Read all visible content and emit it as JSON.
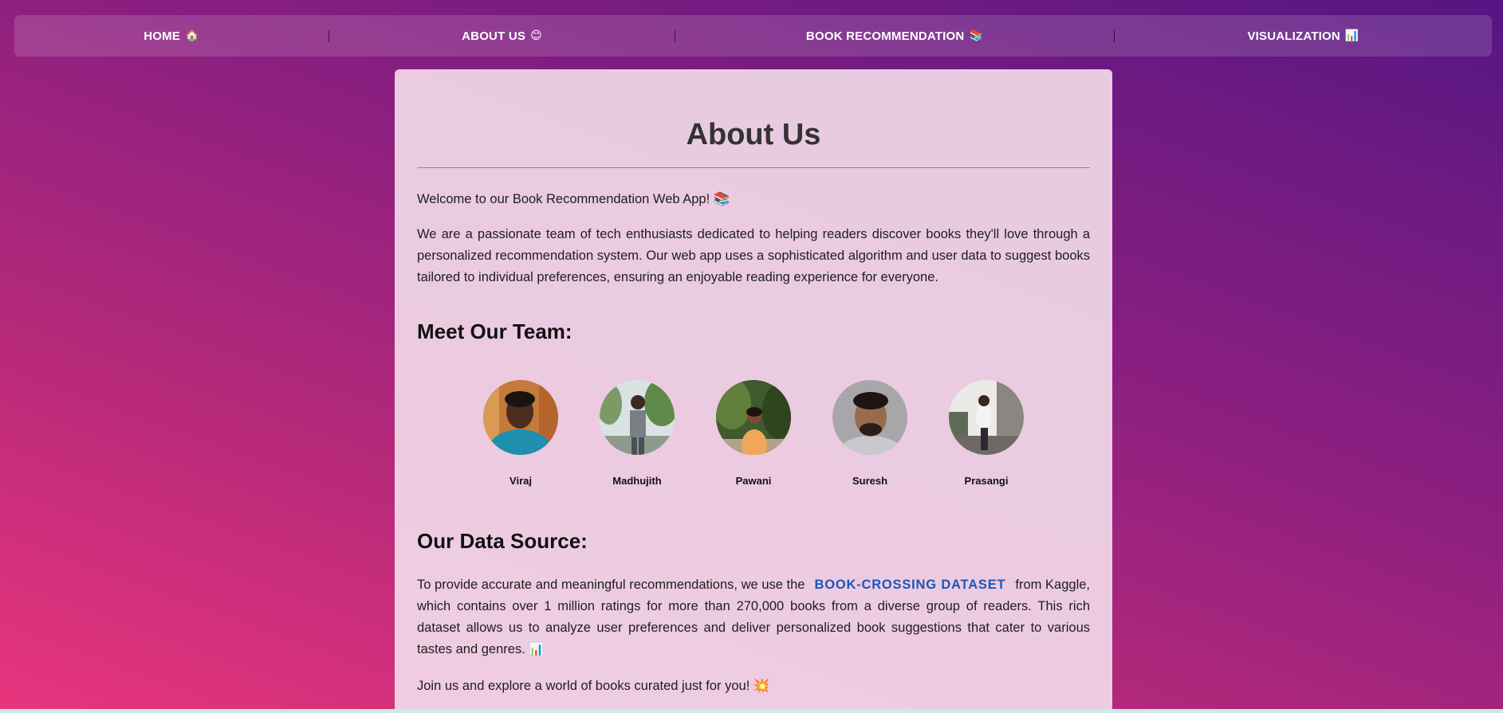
{
  "nav": {
    "items": [
      {
        "label": "HOME",
        "emoji": "🏠"
      },
      {
        "label": "ABOUT US",
        "emoji": "😊"
      },
      {
        "label": "BOOK RECOMMENDATION",
        "emoji": "📚"
      },
      {
        "label": "VISUALIZATION",
        "emoji": "📊"
      }
    ]
  },
  "about": {
    "title": "About Us",
    "welcome": "Welcome to our Book Recommendation Web App! 📚",
    "intro": "We are a passionate team of tech enthusiasts dedicated to helping readers discover books they'll love through a personalized recommendation system. Our web app uses a sophisticated algorithm and user data to suggest books tailored to individual preferences, ensuring an enjoyable reading experience for everyone.",
    "team_heading": "Meet Our Team:",
    "team": [
      {
        "name": "Viraj"
      },
      {
        "name": "Madhujith"
      },
      {
        "name": "Pawani"
      },
      {
        "name": "Suresh"
      },
      {
        "name": "Prasangi"
      }
    ],
    "source_heading": "Our Data Source:",
    "source_before": "To provide accurate and meaningful recommendations, we use the",
    "source_link": "BOOK-CROSSING DATASET",
    "source_after": "from Kaggle, which contains over 1 million ratings for more than 270,000 books from a diverse group of readers. This rich dataset allows us to analyze user preferences and deliver personalized book suggestions that cater to various tastes and genres.",
    "source_emoji": "📊",
    "join": "Join us and explore a world of books curated just for you! 💥"
  },
  "colors": {
    "link": "#1b57b7",
    "title_rule": "#6e8fc9",
    "nav_text": "#ffffff"
  }
}
